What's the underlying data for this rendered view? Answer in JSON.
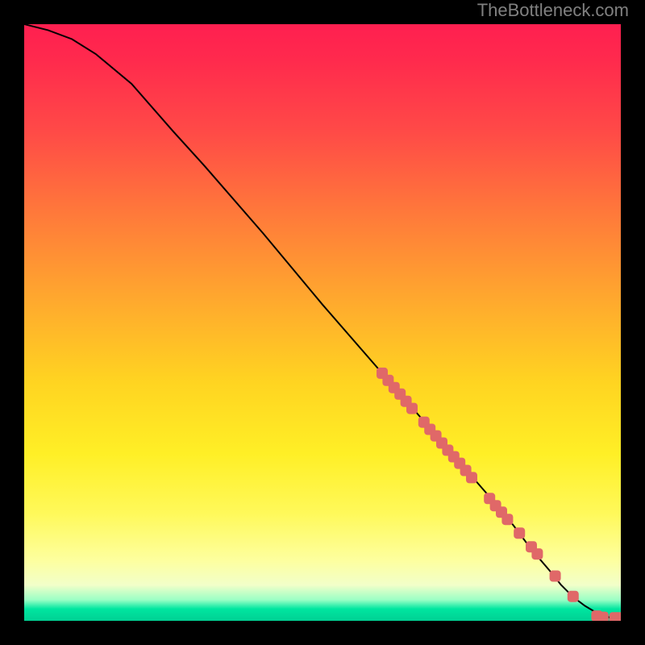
{
  "attribution": "TheBottleneck.com",
  "chart_data": {
    "type": "line",
    "title": "",
    "xlabel": "",
    "ylabel": "",
    "xlim": [
      0,
      100
    ],
    "ylim": [
      0,
      100
    ],
    "grid": false,
    "legend": false,
    "series": [
      {
        "name": "curve",
        "kind": "line",
        "x": [
          0,
          4,
          8,
          12,
          18,
          25,
          30,
          40,
          50,
          60,
          70,
          78,
          82,
          85,
          88,
          90,
          92,
          94,
          96,
          98,
          100
        ],
        "y": [
          100,
          99,
          97.5,
          95,
          90,
          82,
          76.5,
          65,
          53,
          41.5,
          30,
          20.8,
          16,
          12,
          8.5,
          6,
          4,
          2.5,
          1.3,
          0.6,
          0.5
        ]
      },
      {
        "name": "points",
        "kind": "scatter",
        "x": [
          60,
          61,
          62,
          63,
          64,
          65,
          67,
          68,
          69,
          70,
          71,
          72,
          73,
          74,
          75,
          78,
          79,
          80,
          81,
          83,
          85,
          86,
          89,
          92,
          96,
          97,
          99,
          100
        ],
        "y": [
          41.5,
          40.3,
          39.1,
          38.0,
          36.8,
          35.6,
          33.3,
          32.1,
          31.0,
          29.8,
          28.6,
          27.5,
          26.4,
          25.2,
          24.0,
          20.5,
          19.3,
          18.2,
          17.0,
          14.7,
          12.4,
          11.2,
          7.5,
          4.1,
          0.8,
          0.6,
          0.5,
          0.5
        ]
      }
    ]
  }
}
